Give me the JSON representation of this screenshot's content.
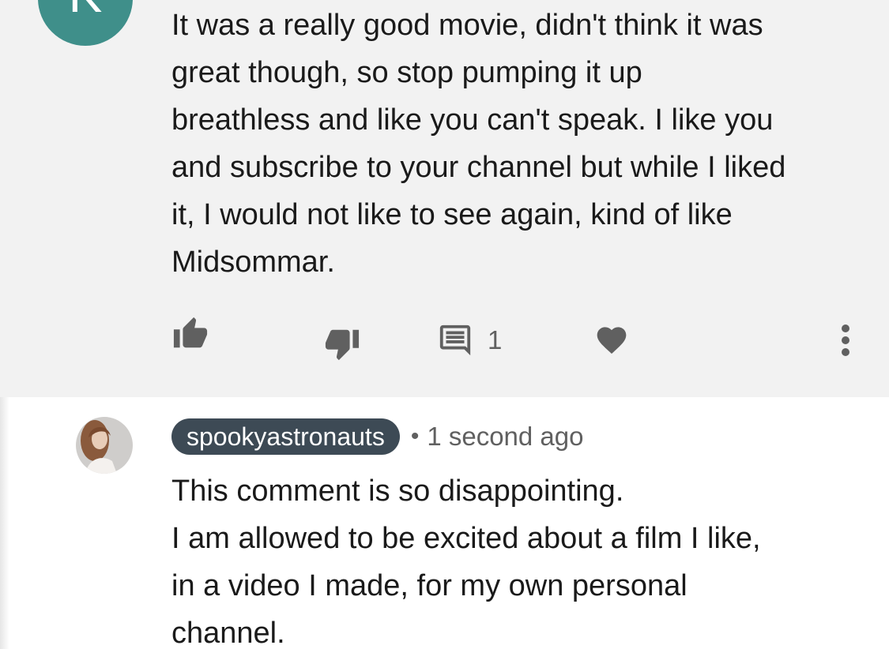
{
  "comment_1": {
    "avatar_letter": "K",
    "avatar_color": "#3f8f8a",
    "text": "It was a really good movie, didn't think it was\ngreat though, so stop pumping it up\nbreathless and like you can't speak.  I like you\nand subscribe to your channel but while I liked\nit, I would not like to see again, kind of like\nMidsommar.",
    "actions": {
      "like_icon": "thumbs-up-icon",
      "dislike_icon": "thumbs-down-icon",
      "reply_icon": "comment-icon",
      "reply_count": "1",
      "heart_icon": "heart-icon",
      "more_icon": "more-vert-icon"
    }
  },
  "comment_2": {
    "author": "spookyastronauts",
    "separator": "•",
    "timestamp": "1 second ago",
    "author_chip_color": "#3d4a55",
    "text": "This comment is so disappointing.\nI am allowed to be excited about a film I like,\nin a video I made, for my own personal\nchannel."
  },
  "colors": {
    "top_background": "#f2f2f2",
    "icon_gray": "#606060",
    "text": "#1a1a1a"
  }
}
